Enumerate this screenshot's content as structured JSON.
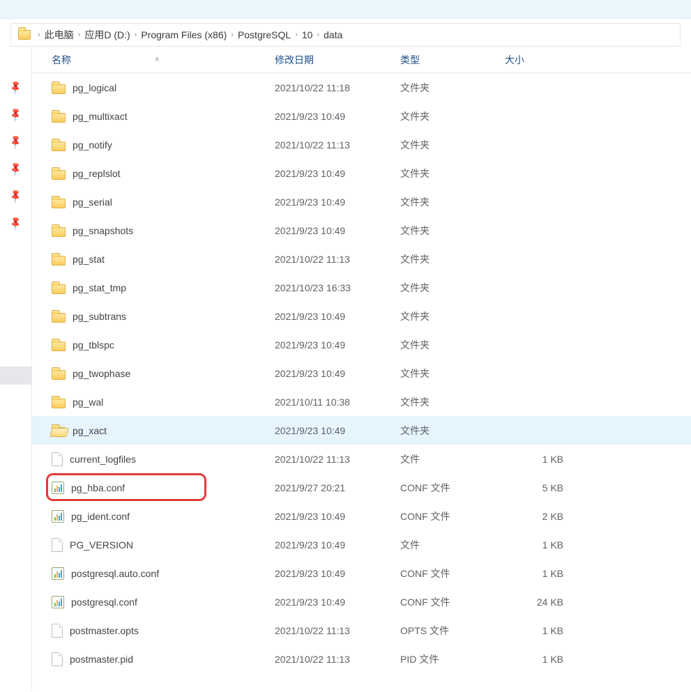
{
  "breadcrumbs": [
    "此电脑",
    "应用D (D:)",
    "Program Files (x86)",
    "PostgreSQL",
    "10",
    "data"
  ],
  "columns": {
    "name": "名称",
    "date": "修改日期",
    "type": "类型",
    "size": "大小"
  },
  "rows": [
    {
      "icon": "folder",
      "name": "pg_logical",
      "date": "2021/10/22 11:18",
      "type": "文件夹",
      "size": ""
    },
    {
      "icon": "folder",
      "name": "pg_multixact",
      "date": "2021/9/23 10:49",
      "type": "文件夹",
      "size": ""
    },
    {
      "icon": "folder",
      "name": "pg_notify",
      "date": "2021/10/22 11:13",
      "type": "文件夹",
      "size": ""
    },
    {
      "icon": "folder",
      "name": "pg_replslot",
      "date": "2021/9/23 10:49",
      "type": "文件夹",
      "size": ""
    },
    {
      "icon": "folder",
      "name": "pg_serial",
      "date": "2021/9/23 10:49",
      "type": "文件夹",
      "size": ""
    },
    {
      "icon": "folder",
      "name": "pg_snapshots",
      "date": "2021/9/23 10:49",
      "type": "文件夹",
      "size": ""
    },
    {
      "icon": "folder",
      "name": "pg_stat",
      "date": "2021/10/22 11:13",
      "type": "文件夹",
      "size": ""
    },
    {
      "icon": "folder",
      "name": "pg_stat_tmp",
      "date": "2021/10/23 16:33",
      "type": "文件夹",
      "size": ""
    },
    {
      "icon": "folder",
      "name": "pg_subtrans",
      "date": "2021/9/23 10:49",
      "type": "文件夹",
      "size": ""
    },
    {
      "icon": "folder",
      "name": "pg_tblspc",
      "date": "2021/9/23 10:49",
      "type": "文件夹",
      "size": ""
    },
    {
      "icon": "folder",
      "name": "pg_twophase",
      "date": "2021/9/23 10:49",
      "type": "文件夹",
      "size": ""
    },
    {
      "icon": "folder",
      "name": "pg_wal",
      "date": "2021/10/11 10:38",
      "type": "文件夹",
      "size": ""
    },
    {
      "icon": "folder-open",
      "name": "pg_xact",
      "date": "2021/9/23 10:49",
      "type": "文件夹",
      "size": "",
      "selected": true
    },
    {
      "icon": "file",
      "name": "current_logfiles",
      "date": "2021/10/22 11:13",
      "type": "文件",
      "size": "1 KB"
    },
    {
      "icon": "conf",
      "name": "pg_hba.conf",
      "date": "2021/9/27 20:21",
      "type": "CONF 文件",
      "size": "5 KB",
      "highlight": true
    },
    {
      "icon": "conf",
      "name": "pg_ident.conf",
      "date": "2021/9/23 10:49",
      "type": "CONF 文件",
      "size": "2 KB"
    },
    {
      "icon": "file",
      "name": "PG_VERSION",
      "date": "2021/9/23 10:49",
      "type": "文件",
      "size": "1 KB"
    },
    {
      "icon": "conf",
      "name": "postgresql.auto.conf",
      "date": "2021/9/23 10:49",
      "type": "CONF 文件",
      "size": "1 KB"
    },
    {
      "icon": "conf",
      "name": "postgresql.conf",
      "date": "2021/9/23 10:49",
      "type": "CONF 文件",
      "size": "24 KB"
    },
    {
      "icon": "file",
      "name": "postmaster.opts",
      "date": "2021/10/22 11:13",
      "type": "OPTS 文件",
      "size": "1 KB"
    },
    {
      "icon": "file",
      "name": "postmaster.pid",
      "date": "2021/10/22 11:13",
      "type": "PID 文件",
      "size": "1 KB"
    }
  ],
  "pins_count": 6
}
